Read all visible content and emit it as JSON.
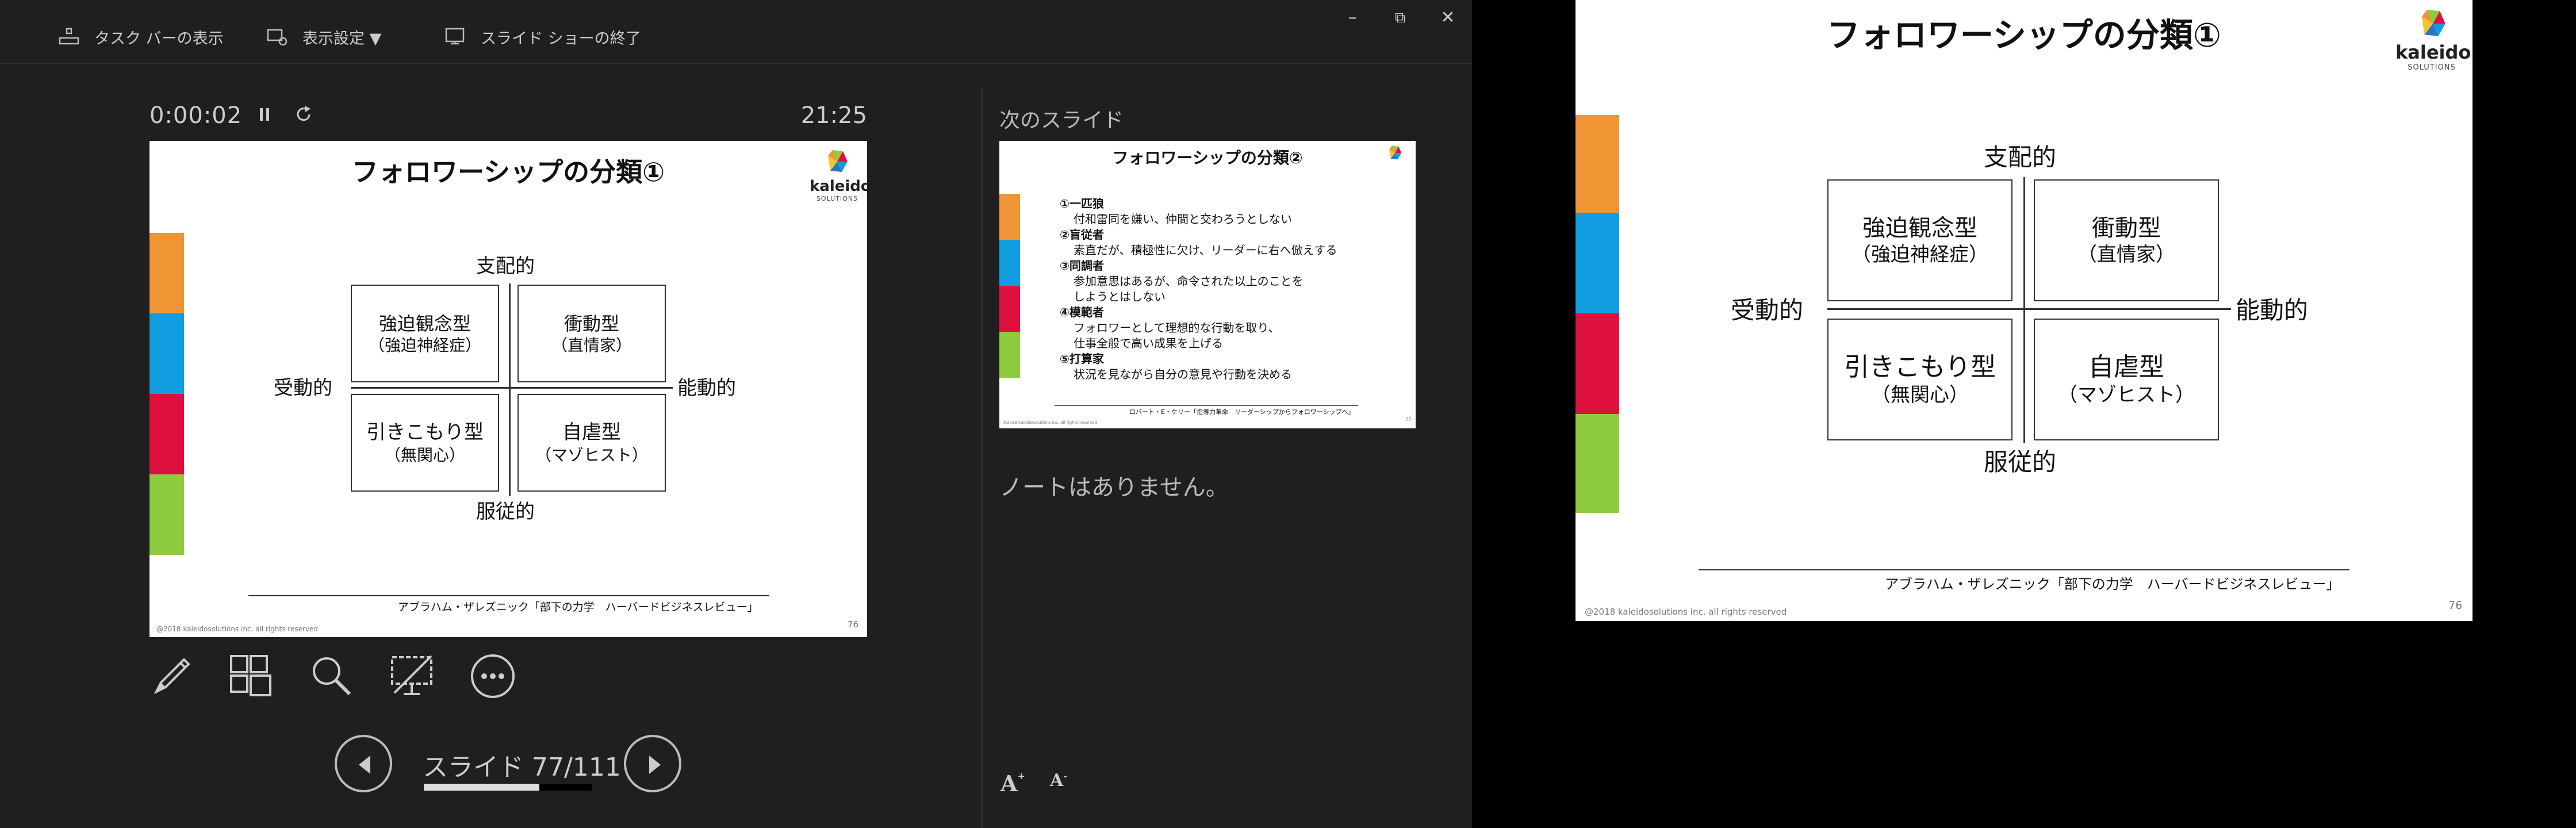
{
  "toolbar": {
    "taskbar_label": "タスク バーの表示",
    "display_settings_label": "表示設定 ▼",
    "end_show_label": "スライド ショーの終了"
  },
  "window": {
    "minimize": "–",
    "restore": "⧉",
    "close": "✕"
  },
  "timer": {
    "elapsed": "0:00:02",
    "clock": "21:25"
  },
  "current_slide": {
    "title": "フォロワーシップの分類①",
    "logo_name": "kaleido",
    "logo_sub": "SOLUTIONS",
    "axis_top": "支配的",
    "axis_bottom": "服従的",
    "axis_left": "受動的",
    "axis_right": "能動的",
    "quadrants": [
      {
        "line1": "強迫観念型",
        "line2": "（強迫神経症）"
      },
      {
        "line1": "衝動型",
        "line2": "（直情家）"
      },
      {
        "line1": "引きこもり型",
        "line2": "（無関心）"
      },
      {
        "line1": "自虐型",
        "line2": "（マゾヒスト）"
      }
    ],
    "source": "アブラハム・ザレズニック「部下の力学　ハーバードビジネスレビュー」",
    "copyright": "@2018 kaleidosolutions inc. all rights reserved",
    "page": "76",
    "bar_colors": [
      "#ef9533",
      "#119ee0",
      "#e0103e",
      "#8fcb3f"
    ]
  },
  "tools": [
    "pen-icon",
    "layout-icon",
    "zoom-icon",
    "black-screen-icon",
    "more-icon"
  ],
  "navigation": {
    "slide_label": "スライド 77/111",
    "progress": 0.69
  },
  "next_slide": {
    "label": "次のスライド",
    "title": "フォロワーシップの分類②",
    "items": [
      {
        "head": "①一匹狼",
        "desc": [
          "付和雷同を嫌い、仲間と交わろうとしない"
        ]
      },
      {
        "head": "②盲従者",
        "desc": [
          "素直だが、積極性に欠け、リーダーに右へ倣えする"
        ]
      },
      {
        "head": "③同調者",
        "desc": [
          "参加意思はあるが、命令された以上のことを",
          "しようとはしない"
        ]
      },
      {
        "head": "④模範者",
        "desc": [
          "フォロワーとして理想的な行動を取り、",
          "仕事全般で高い成果を上げる"
        ]
      },
      {
        "head": "⑤打算家",
        "desc": [
          "状況を見ながら自分の意見や行動を決める"
        ]
      }
    ],
    "source": "ロバート・E・ケリー「指導力革命　リーダーシップからフォロワーシップへ」",
    "copyright": "@2018 kaleidosolutions inc. all rights reserved",
    "page": "77"
  },
  "notes": {
    "text": "ノートはありません。"
  },
  "font_controls": {
    "increase": "A",
    "decrease": "A"
  }
}
